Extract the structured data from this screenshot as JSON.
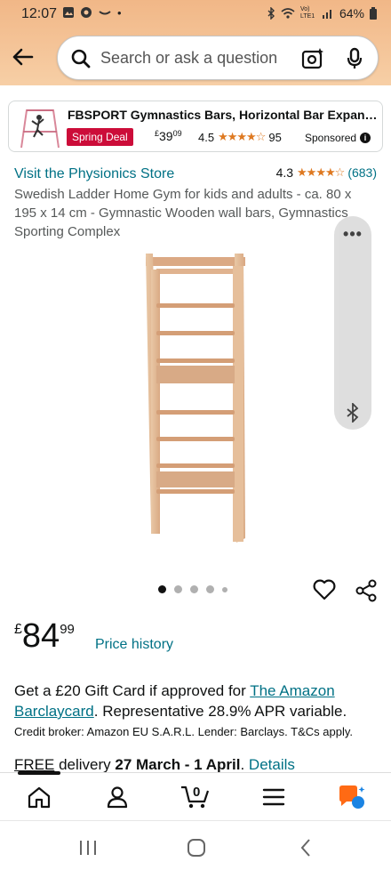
{
  "status_bar": {
    "time": "12:07",
    "dot": "•",
    "network": "Vo) LTE1",
    "battery": "64%"
  },
  "search": {
    "placeholder": "Search or ask a question"
  },
  "ad": {
    "title": "FBSPORT Gymnastics Bars, Horizontal Bar Expandabl...",
    "deal_badge": "Spring Deal",
    "price_symbol": "£",
    "price_whole": "39",
    "price_fraction": "09",
    "rating_value": "4.5",
    "stars": "★★★★☆",
    "rating_count": "95",
    "sponsored_label": "Sponsored"
  },
  "product": {
    "store_link": "Visit the Physionics Store",
    "rating_value": "4.3",
    "stars": "★★★★☆",
    "rating_count": "(683)",
    "title": "Swedish Ladder Home Gym for kids and adults - ca. 80 x 195 x 14 cm - Gymnastic Wooden wall bars, Gymnastics Sporting Complex",
    "image_count": 5,
    "active_image": 1
  },
  "price": {
    "currency": "£",
    "whole": "84",
    "fraction": "99",
    "history_link": "Price history"
  },
  "offer": {
    "text_before": "Get a £20 Gift Card if approved for ",
    "link": "The Amazon Barclaycard",
    "text_after": ". Representative 28.9% APR variable.",
    "credit_line": "Credit broker: Amazon EU S.A.R.L. Lender: Barclays. T&Cs apply."
  },
  "delivery": {
    "free": "FREE",
    "label": " delivery ",
    "dates": "27 March - 1 April",
    "period": ". ",
    "details_link": "Details"
  },
  "cart": {
    "count": "0"
  },
  "colors": {
    "header_bg": "#f1b787",
    "link": "#007185",
    "deal_red": "#cc0c39",
    "star": "#de7921"
  }
}
